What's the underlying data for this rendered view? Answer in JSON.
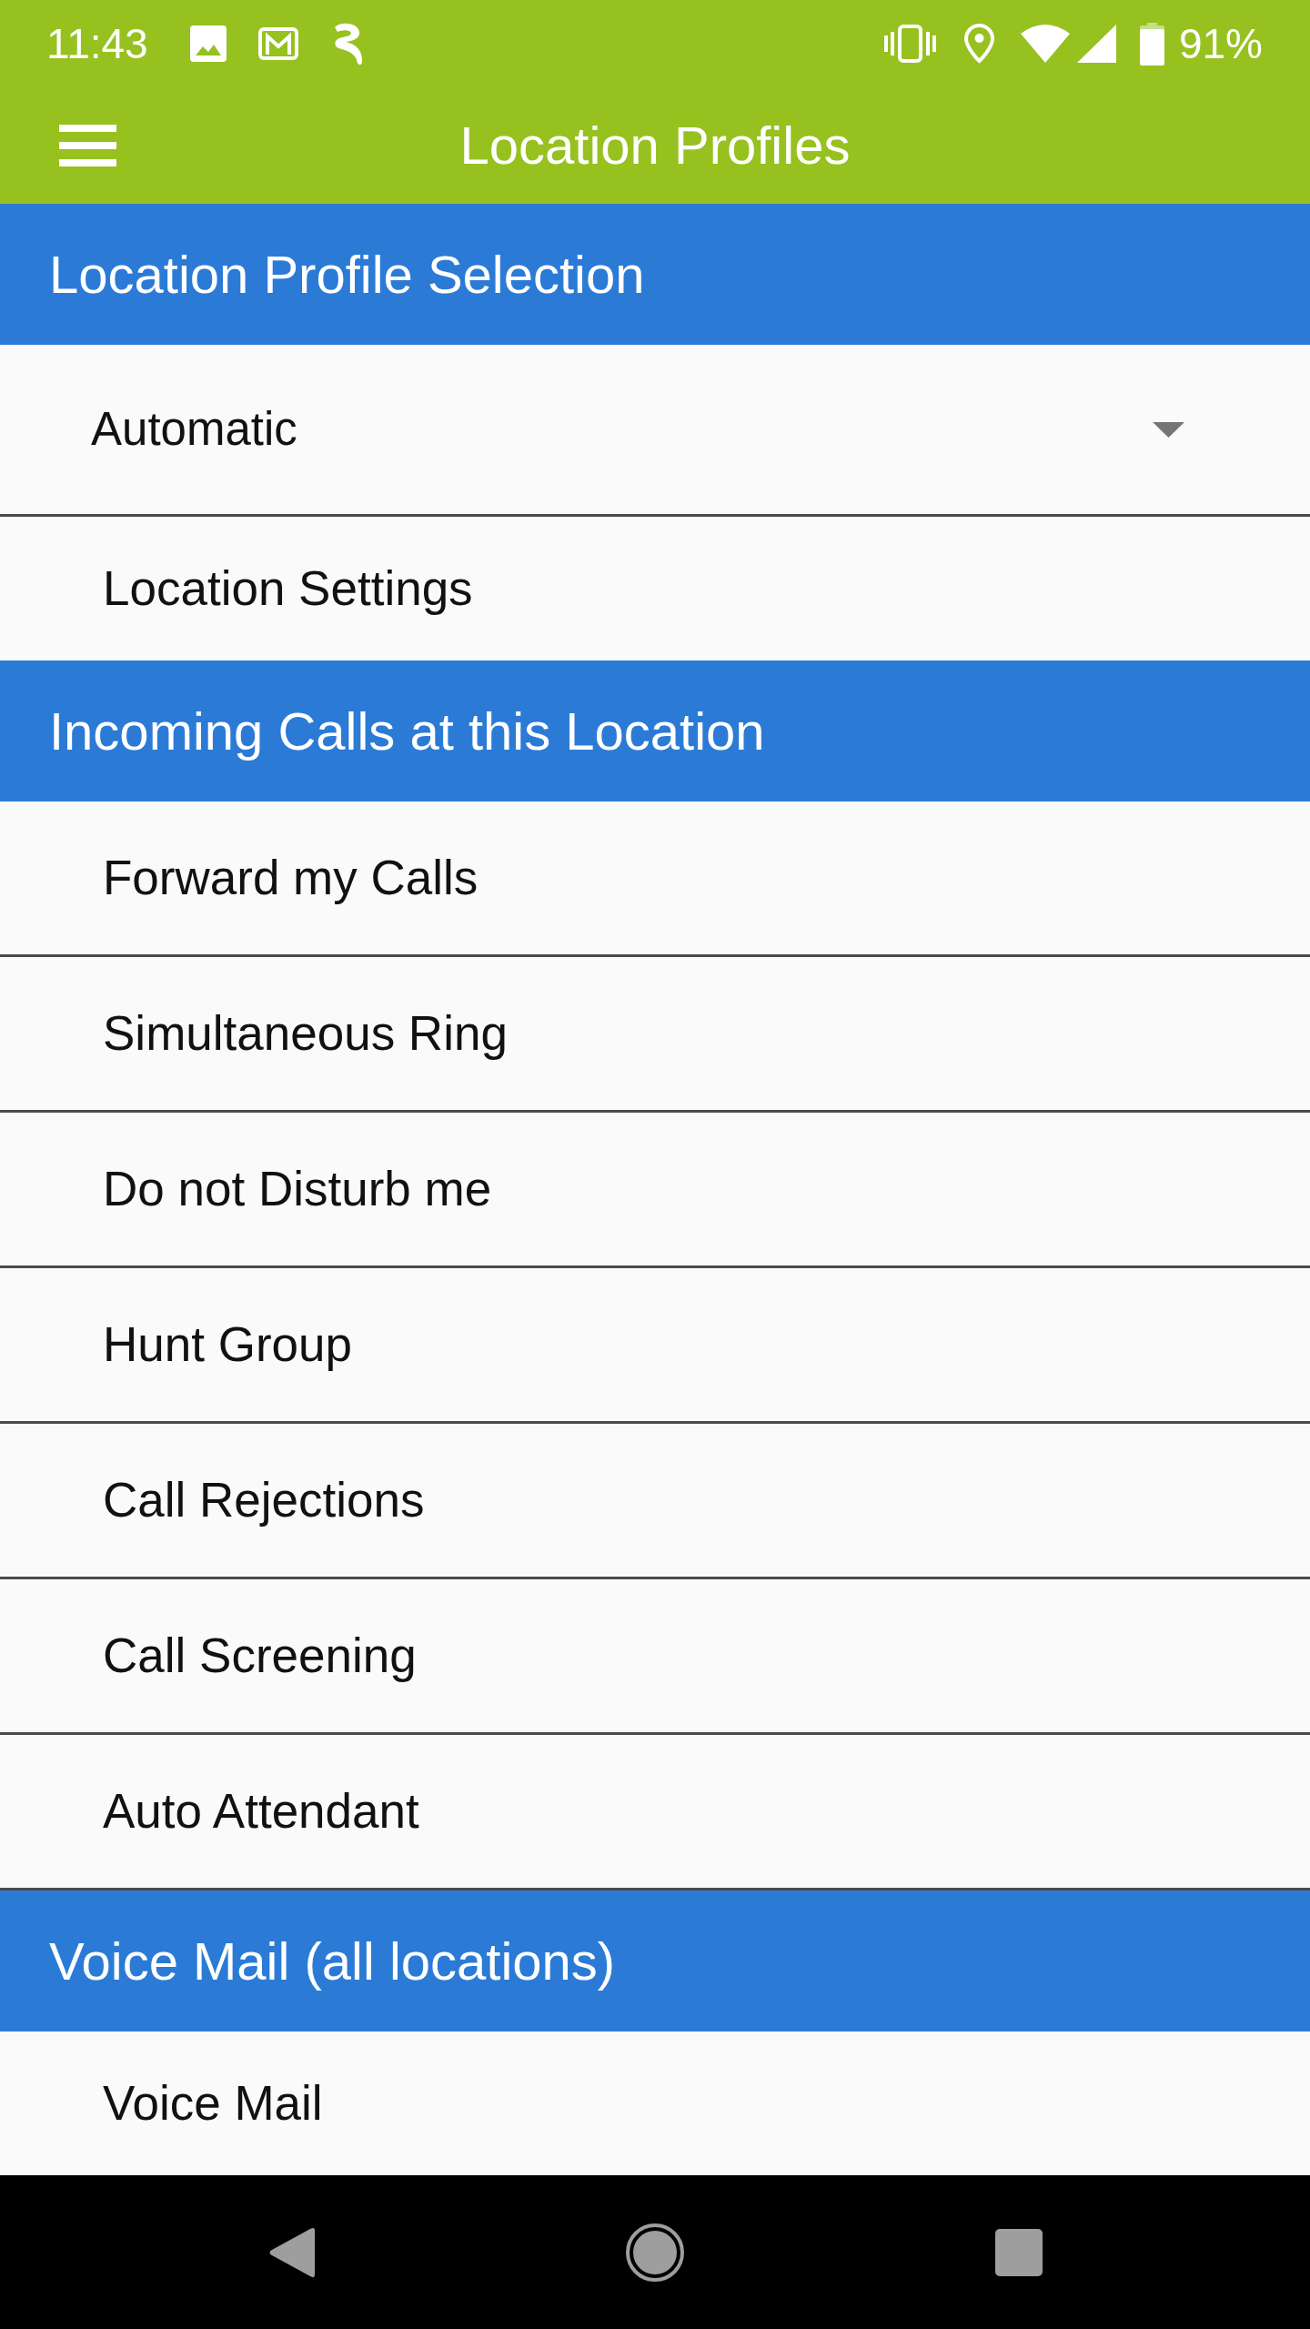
{
  "status_bar": {
    "time": "11:43",
    "battery": "91%"
  },
  "toolbar": {
    "title": "Location Profiles"
  },
  "sections": [
    {
      "title": "Location Profile Selection",
      "items": [
        {
          "kind": "dropdown",
          "value": "Automatic"
        },
        {
          "kind": "button",
          "label": "Location Settings"
        }
      ]
    },
    {
      "title": "Incoming Calls at this Location",
      "items": [
        {
          "kind": "item",
          "label": "Forward my Calls"
        },
        {
          "kind": "item",
          "label": "Simultaneous Ring"
        },
        {
          "kind": "item",
          "label": "Do not Disturb me"
        },
        {
          "kind": "item",
          "label": "Hunt Group"
        },
        {
          "kind": "item",
          "label": "Call Rejections"
        },
        {
          "kind": "item",
          "label": "Call Screening"
        },
        {
          "kind": "item",
          "label": "Auto Attendant"
        }
      ]
    },
    {
      "title": "Voice Mail (all locations)",
      "items": [
        {
          "kind": "button",
          "label": "Voice Mail"
        }
      ]
    }
  ]
}
